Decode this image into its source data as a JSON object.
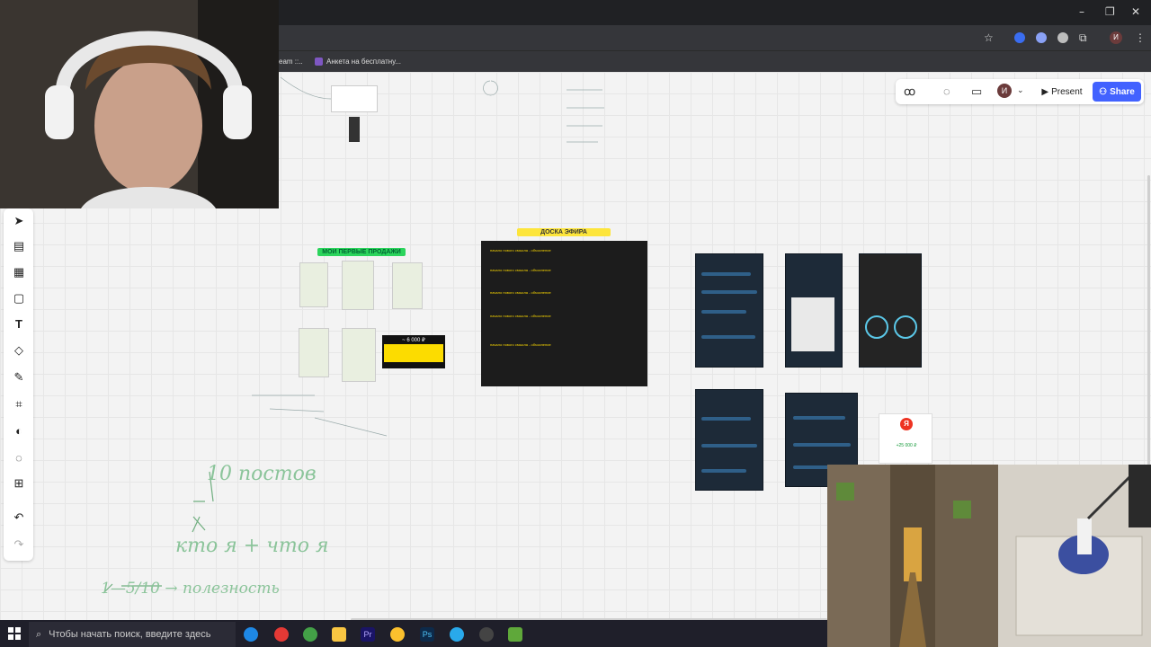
{
  "browser": {
    "bookmarks": [
      {
        "label": "eam ::..",
        "icon": "bookmark-icon"
      },
      {
        "label": "Анкета на бесплатну...",
        "icon": "form-icon"
      }
    ],
    "window_controls": [
      "–",
      "❐",
      "✕"
    ],
    "profile_initial": "И"
  },
  "board": {
    "toolbar": {
      "present_label": "Present",
      "share_label": "Share",
      "avatar_initial": "И",
      "icons": [
        "reactions-icon",
        "chat-icon",
        "video-icon",
        "chevron-down-icon"
      ]
    },
    "left_tools": [
      "select-icon",
      "templates-icon",
      "frame-icon",
      "sticky-note-icon",
      "text-icon",
      "shapes-icon",
      "pen-icon",
      "crop-icon",
      "palette-icon",
      "comment-icon",
      "add-icon",
      "undo-icon",
      "redo-icon"
    ],
    "sections": {
      "sales_title": "МОИ ПЕРВЫЕ ПРОДАЖИ",
      "stream_title": "ДОСКА ЭФИРА",
      "stream_lines": [
        "начало нового смысла - объяснение",
        "начало нового смысла - объяснение",
        "начало нового смысла - объяснение",
        "начало нового смысла - объяснение",
        "начало нового смысла - объяснение"
      ],
      "payment_amount": "~ 6 000 ₽",
      "yandex_amount": "+25 000 ₽"
    },
    "handwriting": {
      "posts": "10 постов",
      "who": "кто я + что я",
      "useful": "1—5/10 → полезность"
    },
    "colors": {
      "accent": "#4262ff",
      "green_tag": "#2bd45c",
      "yellow_tag": "#fde53b"
    }
  },
  "taskbar": {
    "search_placeholder": "Чтобы начать поиск, введите здесь",
    "apps": [
      "edge-icon",
      "chrome-icon",
      "chrome-icon",
      "file-explorer-icon",
      "premiere-icon",
      "chrome-icon",
      "photoshop-icon",
      "telegram-icon",
      "obs-icon",
      "minecraft-icon"
    ]
  }
}
